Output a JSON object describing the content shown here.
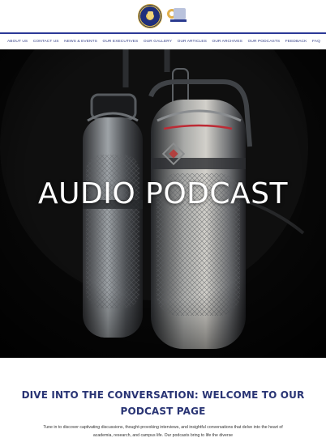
{
  "nav": [
    {
      "label": "ABOUT US"
    },
    {
      "label": "CONTACT US"
    },
    {
      "label": "NEWS & EVENTS"
    },
    {
      "label": "OUR EXECUTIVES"
    },
    {
      "label": "OUR GALLERY"
    },
    {
      "label": "OUR ARTICLES"
    },
    {
      "label": "OUR ARCHIVES"
    },
    {
      "label": "OUR PODCASTS"
    },
    {
      "label": "FEEDBACK"
    },
    {
      "label": "FAQ"
    }
  ],
  "hero": {
    "title": "AUDIO PODCAST"
  },
  "intro": {
    "heading": "DIVE INTO THE CONVERSATION: WELCOME TO OUR PODCAST PAGE",
    "paragraph": "Tune in to discover captivating discussions, thought-provoking interviews, and insightful conversations that delve into the heart of academia, research, and campus life. Our podcasts bring to life the diverse"
  },
  "colors": {
    "accent": "#2b3896",
    "nav_text": "#354087",
    "heading_text": "#293474",
    "hero_bg": "#070707"
  },
  "icons": {
    "left_logo": "university-seal-logo",
    "right_logo": "media-logo"
  }
}
